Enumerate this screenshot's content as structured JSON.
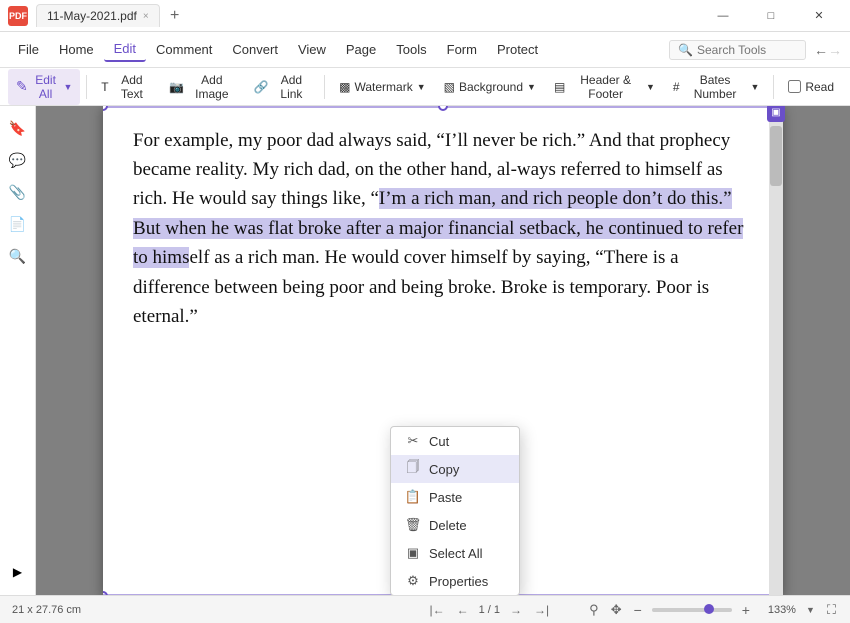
{
  "titlebar": {
    "logo": "PDF",
    "tab_title": "11-May-2021.pdf",
    "close_tab": "×",
    "new_tab": "+",
    "search_placeholder": "Search Tools"
  },
  "menu": {
    "items": [
      "Home",
      "Edit",
      "Comment",
      "Convert",
      "View",
      "Page",
      "Tools",
      "Form",
      "Protect"
    ]
  },
  "toolbar": {
    "edit_all": "Edit All",
    "add_text": "Add Text",
    "add_image": "Add Image",
    "add_link": "Add Link",
    "watermark": "Watermark",
    "background": "Background",
    "header_footer": "Header & Footer",
    "bates_number": "Bates Number",
    "read": "Read"
  },
  "sidebar_icons": [
    "bookmark",
    "comment",
    "attachment",
    "page-thumbnail",
    "search"
  ],
  "page_content": {
    "text_normal_1": "For example, my poor dad always said, “I’ll never be rich.” And that prophecy became reality. My rich dad, on the other hand, al-ways referred to himself as rich. He would say things like, “",
    "text_selected_start": "I’m a rich man, and rich people don’t do this.” B",
    "text_normal_2": "ut when he was flat broke after a major fin",
    "text_selected_end": "ancial setback, he continued to refer to hims",
    "text_normal_3": "elf as a rich man. He would cover himself by saying, “There is a difference between being poor and being broke. Broke is temporary. Poor is eternal.”"
  },
  "context_menu": {
    "items": [
      {
        "icon": "scissors",
        "label": "Cut"
      },
      {
        "icon": "copy",
        "label": "Copy"
      },
      {
        "icon": "paste",
        "label": "Paste"
      },
      {
        "icon": "delete",
        "label": "Delete"
      },
      {
        "icon": "select-all",
        "label": "Select All"
      },
      {
        "icon": "properties",
        "label": "Properties"
      }
    ]
  },
  "status_bar": {
    "dimensions": "21 x 27.76 cm",
    "page_current": "1",
    "page_total": "1",
    "zoom_level": "133%"
  },
  "colors": {
    "accent": "#6a4fc8",
    "selection": "rgba(100,90,200,0.35)",
    "menu_active": "#6a4fc8"
  }
}
